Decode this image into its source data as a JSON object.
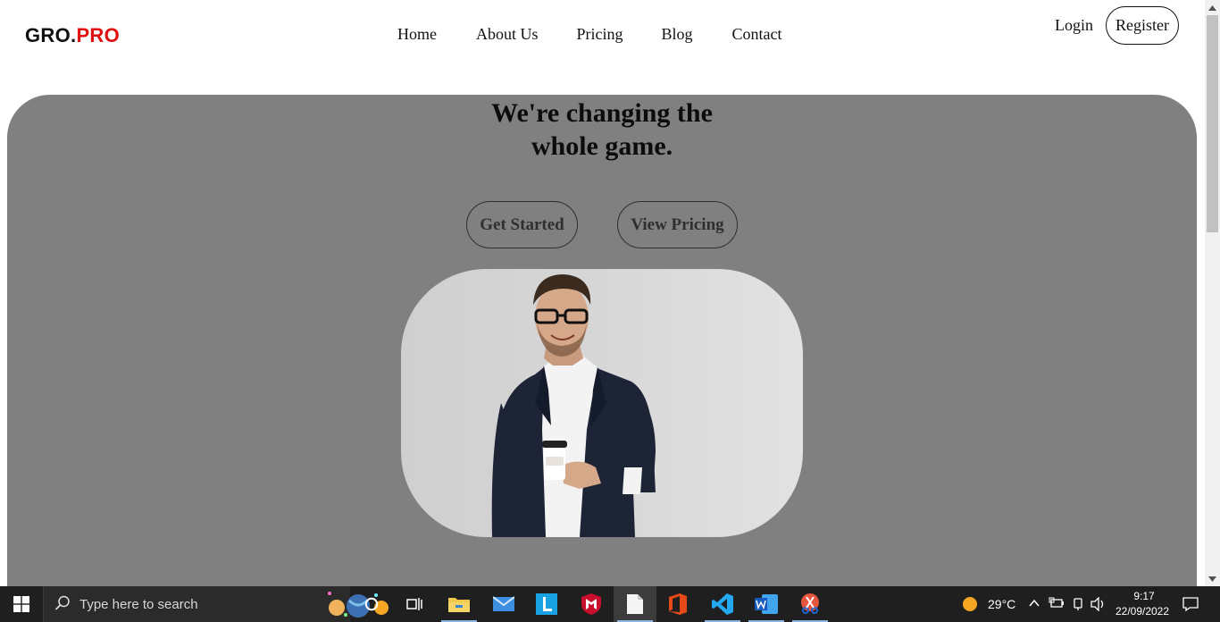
{
  "logo": {
    "part1": "GRO.",
    "part2": "PRO"
  },
  "nav": {
    "items": [
      "Home",
      "About Us",
      "Pricing",
      "Blog",
      "Contact"
    ]
  },
  "auth": {
    "login": "Login",
    "register": "Register"
  },
  "hero": {
    "title_line1": "We're changing the",
    "title_line2": "whole game.",
    "primary_button": "Get Started",
    "secondary_button": "View Pricing",
    "image_subject": "smiling man with glasses holding a coffee cup"
  },
  "taskbar": {
    "search_placeholder": "Type here to search",
    "pinned_apps": [
      "cortana-icon",
      "task-view-icon",
      "file-explorer-icon",
      "mail-icon",
      "learning-app-icon",
      "mcafee-icon",
      "notepad-icon",
      "office-icon",
      "vscode-icon",
      "word-icon",
      "snipping-tool-icon"
    ],
    "weather": "29°C",
    "time": "9:17",
    "date": "22/09/2022"
  },
  "colors": {
    "accent": "#e01010",
    "hero_background": "#808080",
    "taskbar": "#1f1f1f"
  }
}
